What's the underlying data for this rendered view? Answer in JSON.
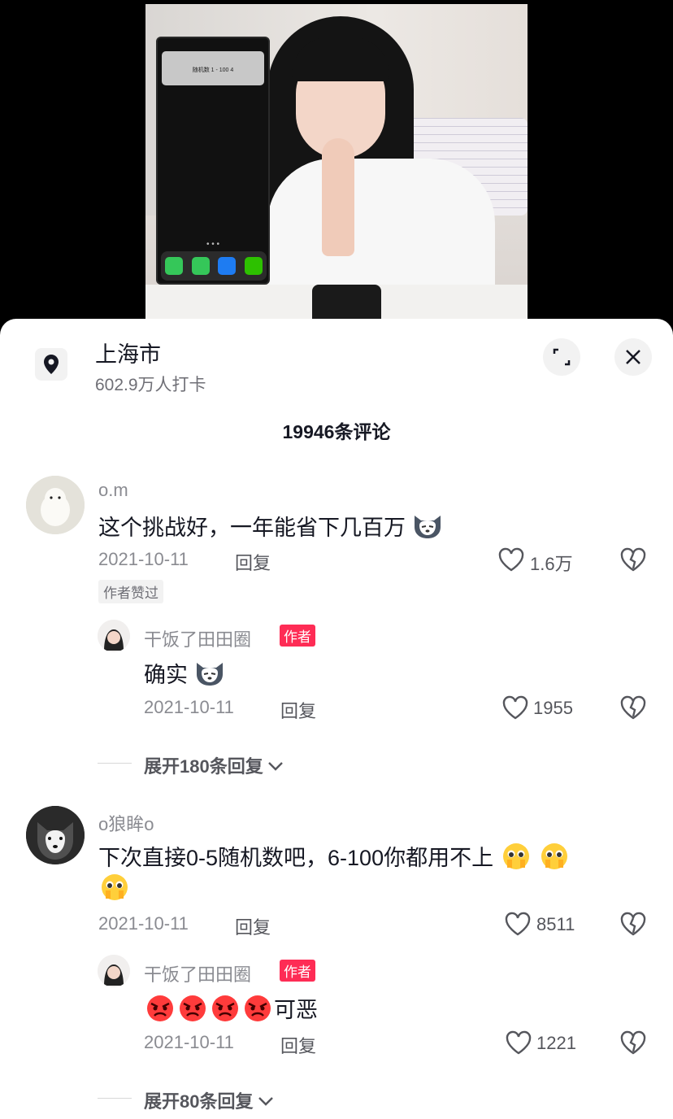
{
  "video": {
    "phone_notification": "随机数 1 - 100 \n 4"
  },
  "location": {
    "name": "上海市",
    "checkins": "602.9万人打卡"
  },
  "comments_header": {
    "count_label": "19946条评论"
  },
  "comments": [
    {
      "username": "o.m",
      "text": "这个挑战好，一年能省下几百万",
      "emoji": "husky-emoji",
      "date": "2021-10-11",
      "reply_label": "回复",
      "likes": "1.6万",
      "author_liked_tag": "作者赞过",
      "reply": {
        "username": "干饭了田田圈",
        "badge": "作者",
        "text": "确实",
        "emoji": "husky-emoji",
        "date": "2021-10-11",
        "reply_label": "回复",
        "likes": "1955"
      },
      "expand_label": "展开180条回复"
    },
    {
      "username": "o狼眸o",
      "text_line1": "下次直接0-5随机数吧，6-100你都用不上",
      "emoji": "pleading-emoji",
      "date": "2021-10-11",
      "reply_label": "回复",
      "likes": "8511",
      "reply": {
        "username": "干饭了田田圈",
        "badge": "作者",
        "text": "可恶",
        "emoji": "angry-emoji",
        "date": "2021-10-11",
        "reply_label": "回复",
        "likes": "1221"
      },
      "expand_label": "展开80条回复"
    }
  ],
  "colors": {
    "accent_red": "#fe2c55",
    "text_primary": "#161823",
    "text_secondary": "#8a8b91"
  }
}
